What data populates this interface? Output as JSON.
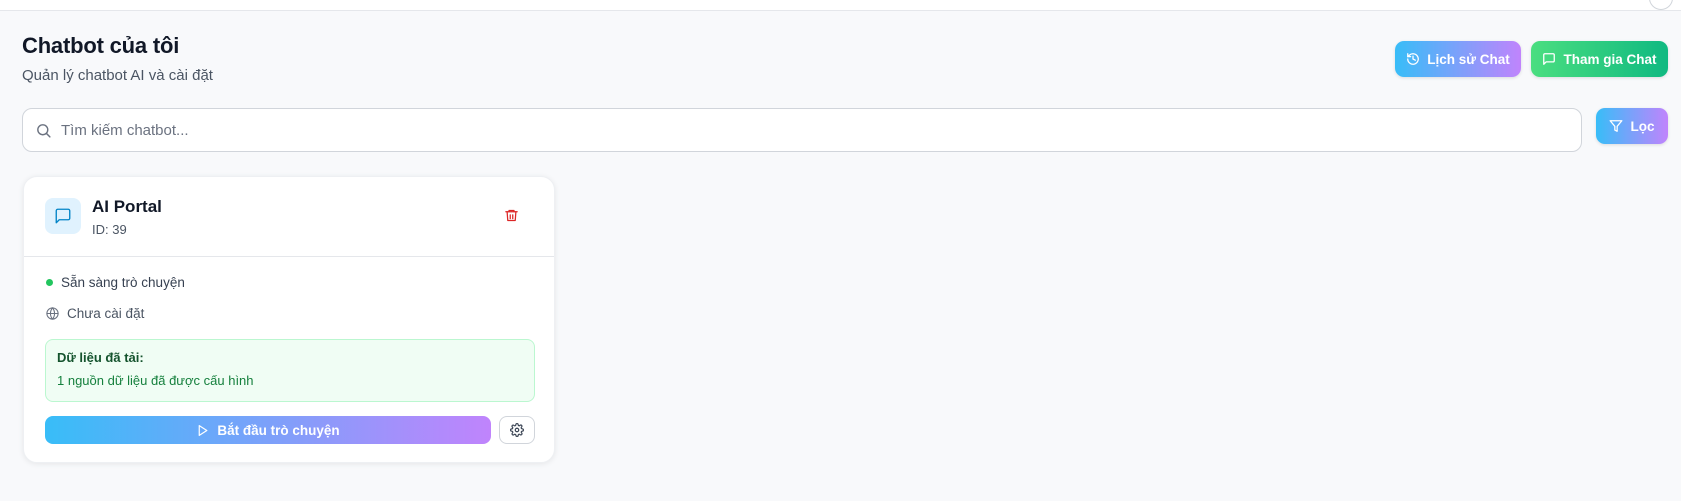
{
  "header": {
    "title": "Chatbot của tôi",
    "subtitle": "Quản lý chatbot AI và cài đặt",
    "history_button": {
      "label": "Lịch sử Chat",
      "icon": "history-icon"
    },
    "join_button": {
      "label": "Tham gia Chat",
      "icon": "message-square-icon"
    }
  },
  "search": {
    "placeholder": "Tìm kiếm chatbot...",
    "value": "",
    "icon": "search-icon"
  },
  "filter_button": {
    "label": "Lọc",
    "icon": "filter-icon"
  },
  "chatbots": [
    {
      "name": "AI Portal",
      "id_text": "ID: 39",
      "icon": "message-square-icon",
      "status": "Sẵn sàng trò chuyện",
      "status_color": "#22c55e",
      "install_status": "Chưa cài đặt",
      "data_title": "Dữ liệu đã tải:",
      "data_desc": "1 nguồn dữ liệu đã được cấu hình",
      "start_button": "Bắt đầu trò chuyện",
      "actions": [
        "trash-icon",
        "settings-icon"
      ]
    }
  ],
  "colors": {
    "accent_gradient_start": "#38bdf8",
    "accent_gradient_end": "#c084fc",
    "green_gradient_start": "#4ade80",
    "green_gradient_end": "#10b981",
    "danger": "#dc2626"
  }
}
